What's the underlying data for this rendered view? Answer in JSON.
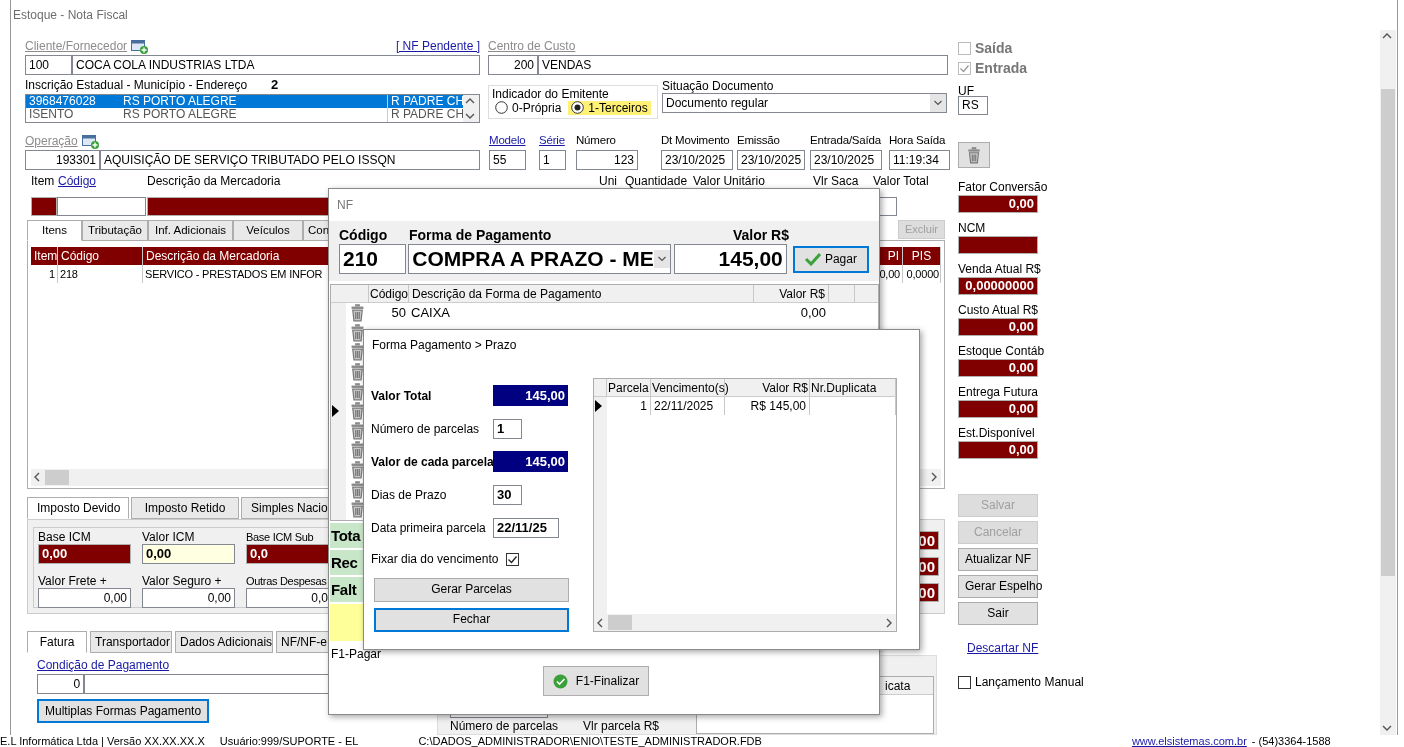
{
  "window": {
    "title": "Estoque - Nota Fiscal"
  },
  "cliente": {
    "label": "Cliente/Fornecedor",
    "code": "100",
    "name": "COCA COLA INDUSTRIAS LTDA",
    "pending_link": "[ NF Pendente ]"
  },
  "centro": {
    "label": "Centro de Custo",
    "code": "200",
    "name": "VENDAS"
  },
  "inscricao": {
    "label": "Inscrição Estadual - Município - Endereço",
    "count": "2",
    "rows": [
      {
        "ie": "3968476028",
        "uf": "RS",
        "city": "PORTO ALEGRE",
        "address": "R PADRE CH",
        "selected": true
      },
      {
        "ie": "ISENTO",
        "uf": "RS",
        "city": "PORTO ALEGRE",
        "address": "R PADRE CH",
        "selected": false
      }
    ]
  },
  "indicador": {
    "label": "Indicador do Emitente",
    "options": [
      {
        "label": "0-Própria",
        "selected": false
      },
      {
        "label": "1-Terceiros",
        "selected": true
      }
    ]
  },
  "situacao": {
    "label": "Situação Documento",
    "value": "Documento regular"
  },
  "operacao": {
    "label": "Operação",
    "code": "193301",
    "name": "AQUISIÇÃO DE SERVIÇO TRIBUTADO PELO ISSQN"
  },
  "doc_fields": [
    {
      "label": "Modelo",
      "value": "55",
      "link": true
    },
    {
      "label": "Série",
      "value": "1",
      "link": true
    },
    {
      "label": "Número",
      "value": "123",
      "link": false
    },
    {
      "label": "Dt Movimento",
      "value": "23/10/2025",
      "link": false
    },
    {
      "label": "Emissão",
      "value": "23/10/2025",
      "link": false
    },
    {
      "label": "Entrada/Saída",
      "value": "23/10/2025",
      "link": false
    },
    {
      "label": "Hora Saída",
      "value": "11:19:34",
      "link": false
    }
  ],
  "item_entry": {
    "labels": [
      {
        "label": "Item",
        "link": false
      },
      {
        "label": "Código",
        "link": true
      },
      {
        "label": "Descrição da Mercadoria",
        "link": false
      },
      {
        "label": "Uni",
        "link": false
      },
      {
        "label": "Quantidade",
        "link": false
      },
      {
        "label": "Valor Unitário",
        "link": false
      },
      {
        "label": "Vlr Saca",
        "link": false
      },
      {
        "label": "Valor Total",
        "link": false
      }
    ]
  },
  "item_tabs": [
    {
      "label": "Itens",
      "selected": true
    },
    {
      "label": "Tributação",
      "selected": false
    },
    {
      "label": "Inf. Adicionais",
      "selected": false
    },
    {
      "label": "Veículos",
      "selected": false
    },
    {
      "label": "Con",
      "selected": false
    }
  ],
  "item_actions": [
    {
      "label": "Excluir",
      "disabled": true
    }
  ],
  "items_grid": {
    "columns": [
      "Item",
      "Código",
      "Descrição da Mercadoria",
      "PI",
      "PIS"
    ],
    "rows": [
      [
        "1",
        "218",
        "SERVICO - PRESTADOS EM INFOR",
        "0,00",
        "0,0000"
      ]
    ]
  },
  "tax_tabs": [
    {
      "label": "Imposto Devido",
      "selected": true
    },
    {
      "label": "Imposto Retido",
      "selected": false
    },
    {
      "label": "Simples Nacio",
      "selected": false
    }
  ],
  "tax_fields": [
    {
      "label": "Base ICM",
      "value": "0,00",
      "kind": "computed"
    },
    {
      "label": "Valor ICM",
      "value": "0,00",
      "kind": "highlight"
    },
    {
      "label": "Base ICM Sub",
      "value": "0,0",
      "kind": "computed"
    },
    {
      "label": "Valor Frete +",
      "value": "0,00",
      "kind": "input"
    },
    {
      "label": "Valor Seguro +",
      "value": "0,00",
      "kind": "input"
    },
    {
      "label": "Outras Despesas",
      "value": "0,0",
      "kind": "input"
    }
  ],
  "tax_totals": [
    "00",
    "00",
    "00"
  ],
  "invoice_tabs": [
    {
      "label": "Fatura",
      "selected": true
    },
    {
      "label": "Transportador",
      "selected": false
    },
    {
      "label": "Dados Adicionais",
      "selected": false
    },
    {
      "label": "NF/NF-e",
      "selected": false
    }
  ],
  "fatura": {
    "condicao_label": "Condição de Pagamento",
    "condicao_code": "0",
    "multi_button": "Multiplas Formas Pagamento",
    "grid_column": "icata",
    "parcelas_label": "Número de parcelas",
    "vlr_parcela_label": "Vlr parcela R$"
  },
  "flags": [
    {
      "label": "Saída",
      "checked": false
    },
    {
      "label": "Entrada",
      "checked": true
    }
  ],
  "uf": {
    "label": "UF",
    "value": "RS"
  },
  "summary_fields": [
    {
      "label": "Fator Conversão",
      "value": "0,00"
    },
    {
      "label": "NCM"
    },
    {
      "label": "Venda Atual R$",
      "value": "0,00000000"
    },
    {
      "label": "Custo Atual R$",
      "value": "0,00"
    },
    {
      "label": "Estoque Contáb",
      "value": "0,00"
    },
    {
      "label": "Entrega Futura",
      "value": "0,00"
    },
    {
      "label": "Est.Disponível",
      "value": "0,00"
    }
  ],
  "actions": [
    {
      "label": "Salvar",
      "disabled": true
    },
    {
      "label": "Cancelar",
      "disabled": true
    },
    {
      "label": "Atualizar NF",
      "disabled": false
    },
    {
      "label": "Gerar Espelho",
      "disabled": false
    },
    {
      "label": "Sair",
      "disabled": false
    }
  ],
  "discard_link": "Descartar NF",
  "manual": {
    "label": "Lançamento Manual",
    "checked": false
  },
  "nf_dialog": {
    "title": "NF",
    "codigo_label": "Código",
    "codigo": "210",
    "forma_label": "Forma de Pagamento",
    "forma": "COMPRA A PRAZO - ME",
    "valor_label": "Valor R$",
    "valor": "145,00",
    "pay_button": "Pagar",
    "columns": [
      "Código",
      "Descrição da Forma de Pagamento",
      "Valor R$"
    ],
    "rows": [
      {
        "kind": "data",
        "code": "50",
        "desc": "CAIXA",
        "value": "0,00",
        "current": false
      },
      {
        "kind": "covered",
        "current": false
      },
      {
        "kind": "covered",
        "current": false
      },
      {
        "kind": "covered",
        "current": false
      },
      {
        "kind": "covered",
        "current": false
      },
      {
        "kind": "covered",
        "current": true
      },
      {
        "kind": "covered",
        "current": false
      },
      {
        "kind": "covered",
        "current": false
      },
      {
        "kind": "covered",
        "current": false
      },
      {
        "kind": "covered",
        "current": false
      },
      {
        "kind": "covered",
        "current": false
      }
    ],
    "totals": [
      "Tota",
      "Rec",
      "Falt"
    ],
    "f1_hint": "F1-Pagar",
    "finish_button": "F1-Finalizar"
  },
  "prazo_dialog": {
    "title": "Forma Pagamento > Prazo",
    "fields": [
      {
        "label": "Valor Total",
        "value": "145,00",
        "kind": "total"
      },
      {
        "label": "Número de parcelas",
        "value": "1",
        "kind": "input"
      },
      {
        "label": "Valor de cada parcela",
        "value": "145,00",
        "kind": "total"
      },
      {
        "label": "Dias de Prazo",
        "value": "30",
        "kind": "input"
      },
      {
        "label": "Data primeira parcela",
        "value": "22/11/25",
        "kind": "input"
      }
    ],
    "fix_day": {
      "label": "Fixar dia do vencimento",
      "checked": true
    },
    "buttons": [
      "Gerar Parcelas",
      "Fechar"
    ],
    "columns": [
      "Parcela",
      "Vencimento(s)",
      "Valor R$",
      "Nr.Duplicata"
    ],
    "rows": [
      {
        "parcela": "1",
        "vencimento": "22/11/2025",
        "valor": "R$ 145,00",
        "current": true
      }
    ]
  },
  "status_bar": [
    "E.L Informática Ltda | Versão XX.XX.XX.X",
    "Usuário:999/SUPORTE - EL",
    "C:\\DADOS_ADMINISTRADOR\\ENIO\\TESTE_ADMINISTRADOR.FDB",
    "www.elsistemas.com.br",
    "- (54)3364-1588"
  ]
}
